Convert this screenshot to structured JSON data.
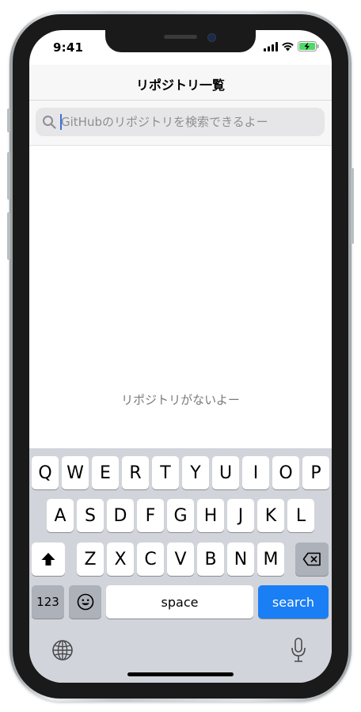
{
  "status_bar": {
    "time": "9:41"
  },
  "nav": {
    "title": "リポジトリ一覧"
  },
  "search": {
    "placeholder": "GitHubのリポジトリを検索できるよー",
    "value": ""
  },
  "empty_state": {
    "text": "リポジトリがないよー"
  },
  "keyboard": {
    "row1": [
      "Q",
      "W",
      "E",
      "R",
      "T",
      "Y",
      "U",
      "I",
      "O",
      "P"
    ],
    "row2": [
      "A",
      "S",
      "D",
      "F",
      "G",
      "H",
      "J",
      "K",
      "L"
    ],
    "row3": [
      "Z",
      "X",
      "C",
      "V",
      "B",
      "N",
      "M"
    ],
    "numbers_label": "123",
    "space_label": "space",
    "search_label": "search"
  },
  "icons": {
    "status": [
      "cellular-signal-icon",
      "wifi-icon",
      "battery-charging-icon"
    ],
    "search": "search-icon",
    "keyboard": [
      "shift-icon",
      "delete-icon",
      "emoji-icon",
      "globe-icon",
      "microphone-icon"
    ]
  },
  "colors": {
    "accent": "#1a7ef5",
    "caret": "#3b6fe0",
    "battery": "#4cd964"
  }
}
